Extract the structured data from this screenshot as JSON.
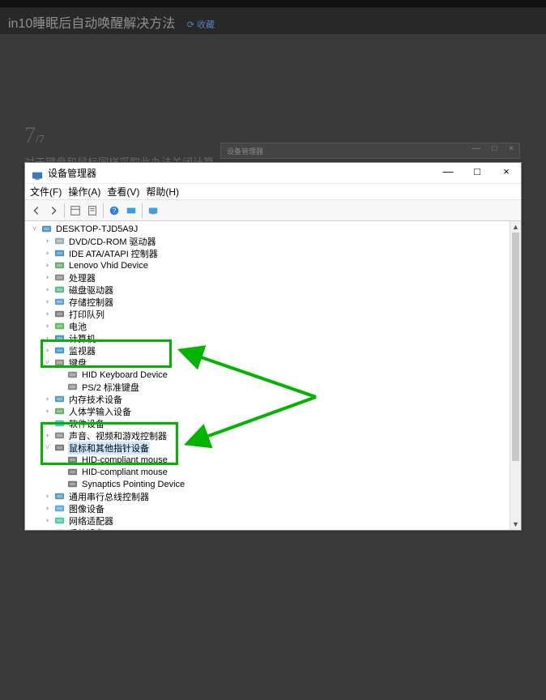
{
  "page": {
    "header_title": "in10睡眠后自动唤醒解决方法",
    "header_link": "⟳ 收藏",
    "step_current": "7",
    "step_total": "/7",
    "step_desc": "对于键盘和鼠标同样采取此办法关闭计算…",
    "mini_title": "设备管理器",
    "mini_ctl": "— □ ×"
  },
  "window": {
    "title": "设备管理器"
  },
  "menu": {
    "file": "文件(F)",
    "action": "操作(A)",
    "view": "查看(V)",
    "help": "帮助(H)"
  },
  "tree": {
    "root": "DESKTOP-TJD5A9J",
    "items": [
      {
        "label": "DVD/CD-ROM 驱动器",
        "icon": "disc"
      },
      {
        "label": "IDE ATA/ATAPI 控制器",
        "icon": "ide"
      },
      {
        "label": "Lenovo Vhid Device",
        "icon": "hid"
      },
      {
        "label": "处理器",
        "icon": "cpu"
      },
      {
        "label": "磁盘驱动器",
        "icon": "disk"
      },
      {
        "label": "存储控制器",
        "icon": "stor"
      },
      {
        "label": "打印队列",
        "icon": "print"
      },
      {
        "label": "电池",
        "icon": "batt"
      },
      {
        "label": "计算机",
        "icon": "pc"
      },
      {
        "label": "监视器",
        "icon": "mon"
      }
    ],
    "kbd_cat": "键盘",
    "kbd_children": [
      "HID Keyboard Device",
      "PS/2 标准键盘"
    ],
    "mid": [
      {
        "label": "内存技术设备",
        "icon": "mem"
      },
      {
        "label": "人体学输入设备",
        "icon": "hid2"
      },
      {
        "label": "软件设备",
        "icon": "soft"
      },
      {
        "label": "声音、视频和游戏控制器",
        "icon": "audio"
      }
    ],
    "mouse_cat": "鼠标和其他指针设备",
    "mouse_children": [
      "HID-compliant mouse",
      "HID-compliant mouse",
      "Synaptics Pointing Device"
    ],
    "tail": [
      {
        "label": "通用串行总线控制器",
        "icon": "usb"
      },
      {
        "label": "图像设备",
        "icon": "cam"
      },
      {
        "label": "网络适配器",
        "icon": "net"
      },
      {
        "label": "系统设备",
        "icon": "sys"
      }
    ]
  }
}
